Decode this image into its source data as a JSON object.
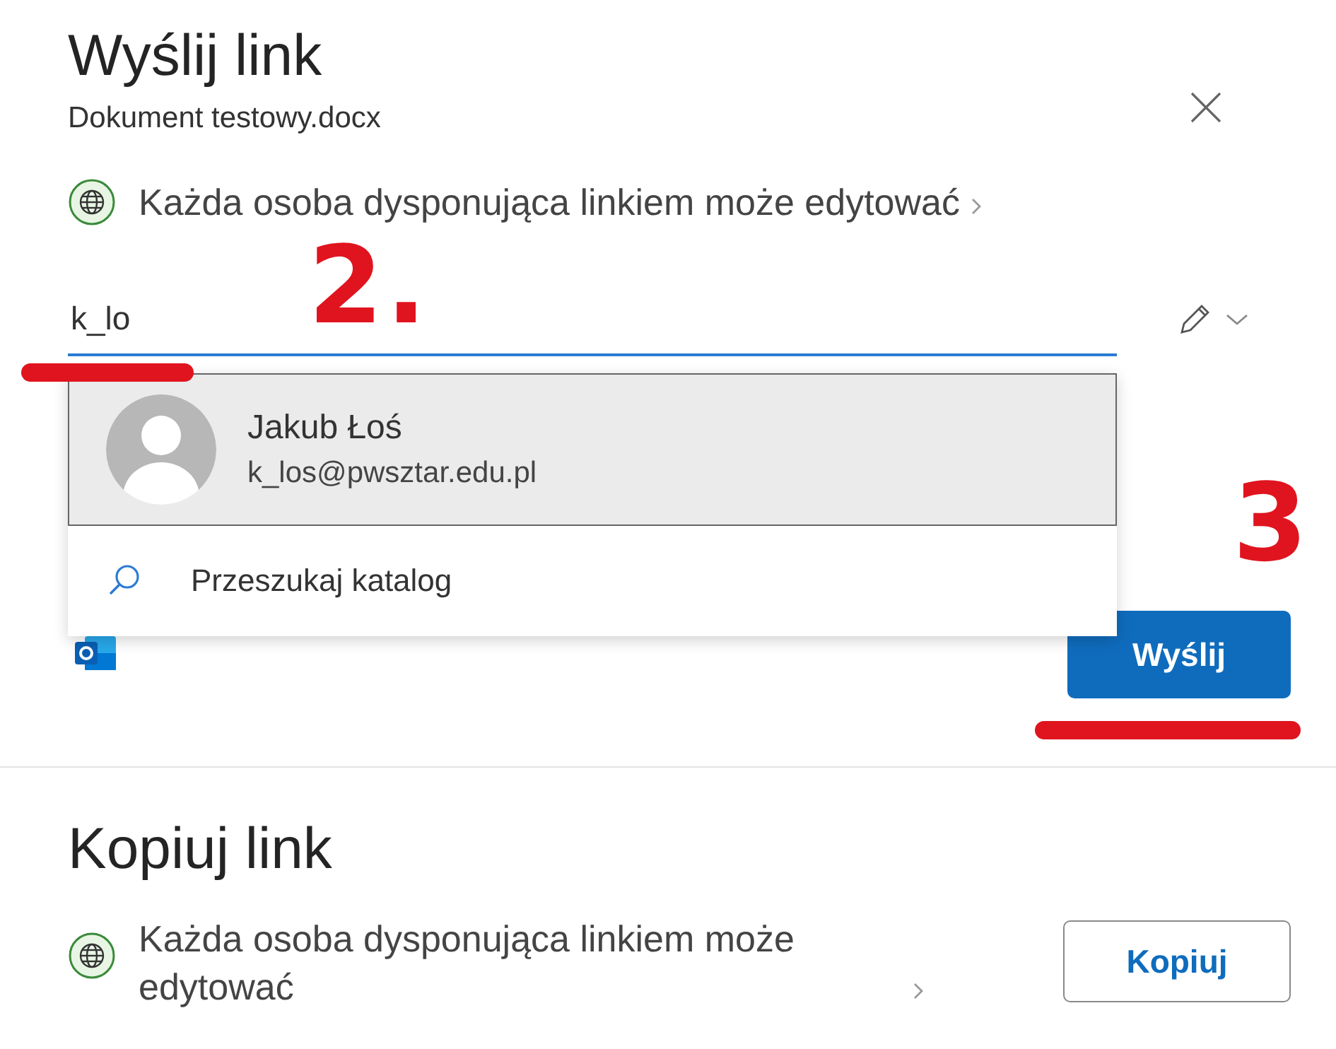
{
  "dialog": {
    "title": "Wyślij link",
    "file_name": "Dokument testowy.docx"
  },
  "send_link": {
    "permission": "Każda osoba dysponująca linkiem może edytować",
    "recipient_field": {
      "value": "k_lo"
    },
    "suggestions": [
      {
        "kind": "person",
        "name": "Jakub Łoś",
        "email": "k_los@pwsztar.edu.pl",
        "selected": true
      },
      {
        "kind": "search",
        "label": "Przeszukaj katalog",
        "selected": false
      }
    ],
    "send_button": "Wyślij"
  },
  "copy_link": {
    "title": "Kopiuj link",
    "permission": "Każda osoba dysponująca linkiem może edytować",
    "copy_button": "Kopiuj"
  },
  "annotations": [
    {
      "label": "2."
    },
    {
      "label": "3"
    }
  ]
}
